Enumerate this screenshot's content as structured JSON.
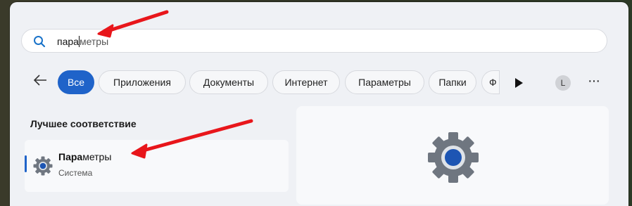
{
  "search": {
    "typed": "пара",
    "suggestion": "метры"
  },
  "filters": {
    "items": [
      "Все",
      "Приложения",
      "Документы",
      "Интернет",
      "Параметры",
      "Папки",
      "Ф"
    ],
    "active_index": 0
  },
  "user": {
    "avatar_letter": "L"
  },
  "best_match": {
    "heading": "Лучшее соответствие",
    "name_bold": "Пара",
    "name_rest": "метры",
    "subtitle": "Система"
  },
  "colors": {
    "accent": "#1f63c9",
    "arrow": "#e8161b",
    "panel": "#eff1f5"
  },
  "icons": [
    "search-icon",
    "back-arrow-icon",
    "play-icon",
    "more-icon",
    "settings-gear-icon"
  ]
}
